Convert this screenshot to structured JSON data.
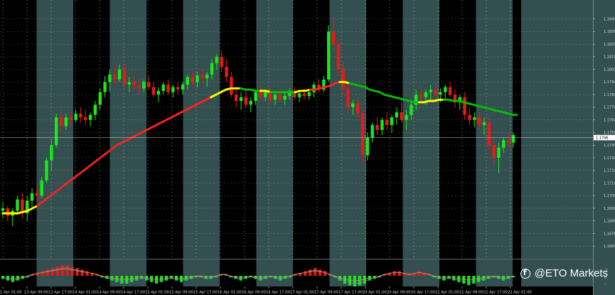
{
  "chart_data": {
    "type": "candlestick",
    "symbol_ohlc": [],
    "price_ticks": [
      "1.1840",
      "1.1830",
      "1.1820",
      "1.1810",
      "1.1800",
      "1.1790",
      "1.1780",
      "1.1770",
      "1.1760",
      "1.1750",
      "1.1740",
      "1.1730",
      "1.1720",
      "1.1710",
      "1.1700",
      "1.1690",
      "1.1680",
      "1.1670",
      "1.1660",
      "1.1650"
    ],
    "price_range": [
      1.165,
      1.1855
    ],
    "current_price_label": "1.1746",
    "current_price": 1.1746,
    "time_ticks": [
      "1 Apr 01:00",
      "13 Apr 09:00",
      "13 Apr 17:00",
      "14 Apr 01:00",
      "14 Apr 09:00",
      "14 Apr 17:00",
      "15 Apr 01:00",
      "15 Apr 09:00",
      "15 Apr 17:00",
      "16 Apr 01:00",
      "16 Apr 09:00",
      "16 Apr 17:00",
      "17 Apr 01:00",
      "17 Apr 09:00",
      "17 Apr 17:00",
      "20 Apr 01:00",
      "20 Apr 09:00",
      "20 Apr 17:00",
      "21 Apr 01:00",
      "21 Apr 09:00",
      "21 Apr 17:00",
      "22 Apr 01:00"
    ],
    "session_shading": "alternating",
    "candles": [
      [
        1.1688,
        1.1695,
        1.1682,
        1.169
      ],
      [
        1.169,
        1.1692,
        1.168,
        1.1684
      ],
      [
        1.1684,
        1.169,
        1.1676,
        1.1688
      ],
      [
        1.1688,
        1.17,
        1.1685,
        1.1697
      ],
      [
        1.1697,
        1.1702,
        1.1682,
        1.1686
      ],
      [
        1.1686,
        1.17,
        1.168,
        1.1696
      ],
      [
        1.1696,
        1.1706,
        1.169,
        1.1702
      ],
      [
        1.1702,
        1.1708,
        1.1695,
        1.17
      ],
      [
        1.17,
        1.1715,
        1.1698,
        1.1712
      ],
      [
        1.1712,
        1.173,
        1.171,
        1.1728
      ],
      [
        1.1728,
        1.1745,
        1.172,
        1.174
      ],
      [
        1.174,
        1.1765,
        1.1738,
        1.1762
      ],
      [
        1.1762,
        1.1768,
        1.175,
        1.1755
      ],
      [
        1.1755,
        1.1765,
        1.1752,
        1.1762
      ],
      [
        1.1762,
        1.1766,
        1.1755,
        1.176
      ],
      [
        1.176,
        1.1768,
        1.1758,
        1.1765
      ],
      [
        1.1765,
        1.177,
        1.1758,
        1.1762
      ],
      [
        1.1762,
        1.1768,
        1.1756,
        1.176
      ],
      [
        1.176,
        1.1766,
        1.1755,
        1.1764
      ],
      [
        1.1764,
        1.1775,
        1.176,
        1.1772
      ],
      [
        1.1772,
        1.1785,
        1.1768,
        1.1782
      ],
      [
        1.1782,
        1.1795,
        1.1778,
        1.179
      ],
      [
        1.179,
        1.18,
        1.1782,
        1.1796
      ],
      [
        1.1796,
        1.1802,
        1.1788,
        1.1792
      ],
      [
        1.1792,
        1.1804,
        1.179,
        1.18
      ],
      [
        1.18,
        1.1805,
        1.1786,
        1.1788
      ],
      [
        1.1788,
        1.1794,
        1.1782,
        1.179
      ],
      [
        1.179,
        1.1795,
        1.1784,
        1.1787
      ],
      [
        1.1787,
        1.1792,
        1.178,
        1.1785
      ],
      [
        1.1785,
        1.1792,
        1.1782,
        1.179
      ],
      [
        1.179,
        1.1795,
        1.1784,
        1.1786
      ],
      [
        1.1786,
        1.179,
        1.1778,
        1.178
      ],
      [
        1.178,
        1.1786,
        1.1774,
        1.1783
      ],
      [
        1.1783,
        1.179,
        1.178,
        1.1788
      ],
      [
        1.1788,
        1.1792,
        1.178,
        1.1782
      ],
      [
        1.1782,
        1.1788,
        1.1778,
        1.1786
      ],
      [
        1.1786,
        1.179,
        1.178,
        1.1784
      ],
      [
        1.1784,
        1.179,
        1.178,
        1.1788
      ],
      [
        1.1788,
        1.1796,
        1.1784,
        1.1794
      ],
      [
        1.1794,
        1.1798,
        1.1786,
        1.179
      ],
      [
        1.179,
        1.1798,
        1.1786,
        1.1795
      ],
      [
        1.1795,
        1.18,
        1.179,
        1.1793
      ],
      [
        1.1793,
        1.1798,
        1.1786,
        1.1796
      ],
      [
        1.1796,
        1.1808,
        1.1792,
        1.1805
      ],
      [
        1.1805,
        1.1812,
        1.18,
        1.181
      ],
      [
        1.181,
        1.1815,
        1.1798,
        1.1802
      ],
      [
        1.1802,
        1.1808,
        1.179,
        1.1794
      ],
      [
        1.1794,
        1.1798,
        1.1778,
        1.178
      ],
      [
        1.178,
        1.1786,
        1.177,
        1.1775
      ],
      [
        1.1775,
        1.1782,
        1.1768,
        1.1778
      ],
      [
        1.1778,
        1.1784,
        1.177,
        1.1772
      ],
      [
        1.1772,
        1.1778,
        1.1766,
        1.1775
      ],
      [
        1.1775,
        1.1784,
        1.1772,
        1.1782
      ],
      [
        1.1782,
        1.1786,
        1.1776,
        1.1778
      ],
      [
        1.1778,
        1.1784,
        1.1775,
        1.1782
      ],
      [
        1.1782,
        1.1786,
        1.1774,
        1.1776
      ],
      [
        1.1776,
        1.1782,
        1.1772,
        1.178
      ],
      [
        1.178,
        1.1784,
        1.1774,
        1.1776
      ],
      [
        1.1776,
        1.1782,
        1.1772,
        1.1779
      ],
      [
        1.1779,
        1.1785,
        1.1776,
        1.1783
      ],
      [
        1.1783,
        1.1786,
        1.1776,
        1.1778
      ],
      [
        1.1778,
        1.1784,
        1.1774,
        1.1781
      ],
      [
        1.1781,
        1.1785,
        1.1776,
        1.1779
      ],
      [
        1.1779,
        1.1784,
        1.1776,
        1.1782
      ],
      [
        1.1782,
        1.179,
        1.1778,
        1.1788
      ],
      [
        1.1788,
        1.1792,
        1.1782,
        1.1784
      ],
      [
        1.1784,
        1.1795,
        1.1782,
        1.1792
      ],
      [
        1.1792,
        1.1835,
        1.179,
        1.183
      ],
      [
        1.183,
        1.1842,
        1.1815,
        1.182
      ],
      [
        1.182,
        1.1824,
        1.1795,
        1.18
      ],
      [
        1.18,
        1.1806,
        1.178,
        1.1785
      ],
      [
        1.1785,
        1.179,
        1.1765,
        1.177
      ],
      [
        1.177,
        1.1776,
        1.1764,
        1.1773
      ],
      [
        1.1773,
        1.1778,
        1.176,
        1.1765
      ],
      [
        1.1765,
        1.1768,
        1.1726,
        1.1732
      ],
      [
        1.1732,
        1.175,
        1.1728,
        1.1746
      ],
      [
        1.1746,
        1.1758,
        1.1742,
        1.1756
      ],
      [
        1.1756,
        1.1762,
        1.1748,
        1.1752
      ],
      [
        1.1752,
        1.1762,
        1.1748,
        1.176
      ],
      [
        1.176,
        1.1766,
        1.1752,
        1.1756
      ],
      [
        1.1756,
        1.1764,
        1.175,
        1.1762
      ],
      [
        1.1762,
        1.177,
        1.1756,
        1.1766
      ],
      [
        1.1766,
        1.1774,
        1.1758,
        1.176
      ],
      [
        1.176,
        1.1768,
        1.1752,
        1.1764
      ],
      [
        1.1764,
        1.1776,
        1.176,
        1.1772
      ],
      [
        1.1772,
        1.1784,
        1.1768,
        1.178
      ],
      [
        1.178,
        1.1786,
        1.1774,
        1.1778
      ],
      [
        1.1778,
        1.1784,
        1.1772,
        1.1782
      ],
      [
        1.1782,
        1.1788,
        1.1776,
        1.1784
      ],
      [
        1.1784,
        1.179,
        1.1778,
        1.178
      ],
      [
        1.178,
        1.1785,
        1.1774,
        1.1782
      ],
      [
        1.1782,
        1.1788,
        1.1776,
        1.1786
      ],
      [
        1.1786,
        1.179,
        1.1778,
        1.178
      ],
      [
        1.178,
        1.1784,
        1.177,
        1.1774
      ],
      [
        1.1774,
        1.178,
        1.1768,
        1.1778
      ],
      [
        1.1778,
        1.1782,
        1.176,
        1.1764
      ],
      [
        1.1764,
        1.177,
        1.1756,
        1.176
      ],
      [
        1.176,
        1.1766,
        1.1754,
        1.1762
      ],
      [
        1.1762,
        1.1766,
        1.1752,
        1.1756
      ],
      [
        1.1756,
        1.1762,
        1.1748,
        1.1758
      ],
      [
        1.1758,
        1.1762,
        1.1736,
        1.174
      ],
      [
        1.174,
        1.1746,
        1.1724,
        1.173
      ],
      [
        1.173,
        1.1742,
        1.1718,
        1.1738
      ],
      [
        1.1738,
        1.1746,
        1.1734,
        1.1744
      ],
      [
        1.1744,
        1.175,
        1.1738,
        1.1742
      ],
      [
        1.1742,
        1.175,
        1.1738,
        1.1748
      ]
    ],
    "ma_line": [
      1.1686,
      1.1686,
      1.1686,
      1.1686,
      1.1687,
      1.1688,
      1.169,
      1.1692,
      1.1695,
      1.1698,
      1.1701,
      1.1704,
      1.1707,
      1.171,
      1.1713,
      1.1716,
      1.1719,
      1.1722,
      1.1725,
      1.1728,
      1.1731,
      1.1734,
      1.1737,
      1.174,
      1.1742,
      1.1744,
      1.1746,
      1.1748,
      1.175,
      1.1752,
      1.1754,
      1.1756,
      1.1758,
      1.176,
      1.1762,
      1.1764,
      1.1766,
      1.1768,
      1.177,
      1.1772,
      1.1774,
      1.1776,
      1.1778,
      1.178,
      1.1782,
      1.1784,
      1.1785,
      1.1785,
      1.1785,
      1.1784,
      1.1784,
      1.1783,
      1.1783,
      1.1783,
      1.1782,
      1.1782,
      1.1782,
      1.1782,
      1.1782,
      1.1782,
      1.1783,
      1.1783,
      1.1784,
      1.1784,
      1.1785,
      1.1786,
      1.1787,
      1.1789,
      1.179,
      1.179,
      1.1789,
      1.1788,
      1.1787,
      1.1786,
      1.1784,
      1.1783,
      1.1782,
      1.178,
      1.1779,
      1.1778,
      1.1777,
      1.1776,
      1.1775,
      1.1774,
      1.1774,
      1.1774,
      1.1775,
      1.1775,
      1.1776,
      1.1776,
      1.1776,
      1.1775,
      1.1775,
      1.1774,
      1.1773,
      1.1772,
      1.1771,
      1.177,
      1.1769,
      1.1768,
      1.1767,
      1.1766,
      1.1765,
      1.1764
    ],
    "ma_colors": [
      "yellow",
      "yellow",
      "yellow",
      "yellow",
      "yellow",
      "yellow",
      "yellow",
      "red",
      "red",
      "red",
      "red",
      "red",
      "red",
      "red",
      "red",
      "red",
      "red",
      "red",
      "red",
      "red",
      "red",
      "red",
      "red",
      "red",
      "red",
      "red",
      "red",
      "red",
      "red",
      "red",
      "red",
      "red",
      "red",
      "red",
      "red",
      "red",
      "red",
      "red",
      "red",
      "red",
      "red",
      "red",
      "yellow",
      "yellow",
      "yellow",
      "yellow",
      "yellow",
      "yellow",
      "green",
      "green",
      "green",
      "green",
      "yellow",
      "yellow",
      "green",
      "green",
      "green",
      "green",
      "green",
      "yellow",
      "yellow",
      "yellow",
      "red",
      "red",
      "red",
      "red",
      "red",
      "red",
      "yellow",
      "yellow",
      "green",
      "green",
      "green",
      "green",
      "green",
      "green",
      "green",
      "green",
      "green",
      "green",
      "green",
      "green",
      "green",
      "green",
      "yellow",
      "yellow",
      "yellow",
      "yellow",
      "yellow",
      "green",
      "green",
      "green",
      "green",
      "green",
      "green",
      "green",
      "green",
      "green",
      "green",
      "green",
      "green",
      "green",
      "green",
      "green"
    ],
    "histogram": [
      -2,
      -3,
      -4,
      -3,
      -2,
      -1,
      1,
      2,
      3,
      4,
      5,
      6,
      7,
      7,
      6,
      5,
      4,
      3,
      2,
      1,
      -1,
      -2,
      -3,
      -4,
      -5,
      -5,
      -4,
      -3,
      -2,
      -3,
      -4,
      -5,
      -4,
      -3,
      -2,
      -3,
      -4,
      -3,
      -2,
      -1,
      -1,
      -2,
      -2,
      -1,
      1,
      1,
      -1,
      -2,
      -3,
      -2,
      -1,
      -2,
      -3,
      -2,
      -1,
      -2,
      -3,
      -2,
      -1,
      1,
      2,
      3,
      4,
      5,
      4,
      3,
      1,
      -1,
      -3,
      -5,
      -6,
      -7,
      -6,
      -5,
      -3,
      -2,
      -1,
      1,
      2,
      3,
      3,
      2,
      1,
      2,
      3,
      2,
      1,
      -1,
      -2,
      -3,
      -2,
      -3,
      -4,
      -5,
      -6,
      -5,
      -4,
      -3,
      -2,
      -1,
      -2,
      -3,
      -2,
      -1
    ]
  },
  "watermark": {
    "icon": "facebook-icon",
    "text": "@ETO Markets"
  },
  "colors": {
    "background": "#000000",
    "band": "#344f4f",
    "bull": "#19e819",
    "bear": "#e81919",
    "ma_red": "#ff2222",
    "ma_yellow": "#ffff00",
    "ma_green": "#00c000",
    "grid": "#ffffff",
    "axis": "#cfd8d8"
  }
}
